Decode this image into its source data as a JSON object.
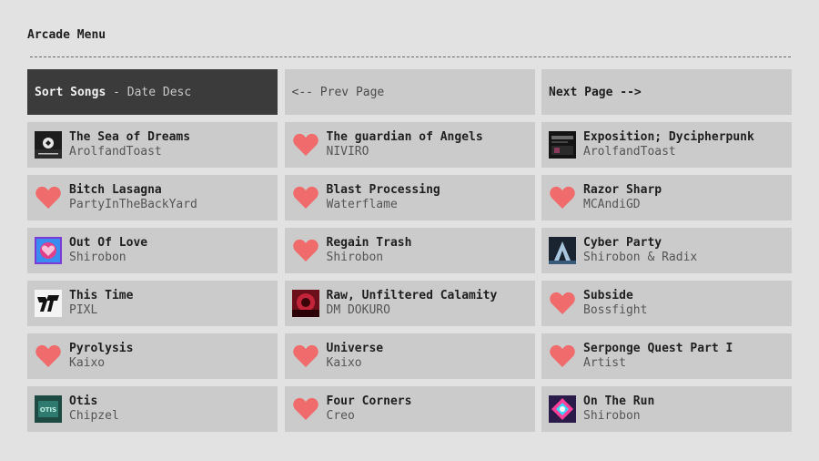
{
  "menu": {
    "title": "Arcade Menu"
  },
  "nav": {
    "sort_label": "Sort Songs",
    "sort_sep": " - ",
    "sort_value": "Date Desc",
    "prev_label": "<-- Prev Page",
    "next_label": "Next Page -->"
  },
  "colors": {
    "heart": "#f06b6b",
    "active_bg": "#3b3b3b",
    "cell_bg": "#cbcbcb",
    "page_bg": "#e2e2e2"
  },
  "songs": [
    {
      "title": "The Sea of Dreams",
      "artist": "ArolfandToast",
      "icon": "album-art-sea-of-dreams"
    },
    {
      "title": "The guardian of Angels",
      "artist": "NIVIRO",
      "icon": "heart-icon"
    },
    {
      "title": "Exposition; Dycipherpunk",
      "artist": "ArolfandToast",
      "icon": "album-art-dycipherpunk"
    },
    {
      "title": "Bitch Lasagna",
      "artist": "PartyInTheBackYard",
      "icon": "heart-icon"
    },
    {
      "title": "Blast Processing",
      "artist": "Waterflame",
      "icon": "heart-icon"
    },
    {
      "title": "Razor Sharp",
      "artist": "MCAndiGD",
      "icon": "heart-icon"
    },
    {
      "title": "Out Of Love",
      "artist": "Shirobon",
      "icon": "album-art-out-of-love"
    },
    {
      "title": "Regain Trash",
      "artist": "Shirobon",
      "icon": "heart-icon"
    },
    {
      "title": "Cyber Party",
      "artist": "Shirobon & Radix",
      "icon": "album-art-cyber-party"
    },
    {
      "title": "This Time",
      "artist": "PIXL",
      "icon": "album-art-this-time"
    },
    {
      "title": "Raw, Unfiltered Calamity",
      "artist": "DM DOKURO",
      "icon": "album-art-calamity"
    },
    {
      "title": "Subside",
      "artist": "Bossfight",
      "icon": "heart-icon"
    },
    {
      "title": "Pyrolysis",
      "artist": "Kaixo",
      "icon": "heart-icon"
    },
    {
      "title": "Universe",
      "artist": "Kaixo",
      "icon": "heart-icon"
    },
    {
      "title": "Serponge Quest Part I",
      "artist": "Artist",
      "icon": "heart-icon"
    },
    {
      "title": "Otis",
      "artist": "Chipzel",
      "icon": "album-art-otis"
    },
    {
      "title": "Four Corners",
      "artist": "Creo",
      "icon": "heart-icon"
    },
    {
      "title": "On The Run",
      "artist": "Shirobon",
      "icon": "album-art-on-the-run"
    }
  ]
}
